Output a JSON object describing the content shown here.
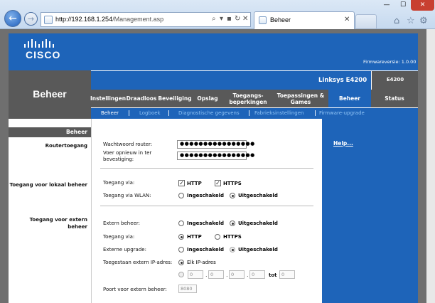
{
  "browser": {
    "url_host": "http://192.168.1.254",
    "url_path": "/Management.asp",
    "addr_icons": [
      "⌕",
      "▾",
      "▪",
      "↻",
      "✕"
    ],
    "tab_title": "Beheer",
    "tab_close": "✕",
    "back_glyph": "←",
    "fwd_glyph": "→",
    "min_glyph": "—",
    "max_glyph": "☐",
    "close_glyph": "✕",
    "home_icon": "⌂",
    "star_icon": "☆",
    "gear_icon": "⚙"
  },
  "header": {
    "logo": "CISCO",
    "firmware": "Firmwareversie: 1.0.00"
  },
  "section": {
    "title": "Beheer"
  },
  "model": {
    "name": "Linksys E4200",
    "code": "E4200"
  },
  "tabs": [
    {
      "label": "Instellingen"
    },
    {
      "label": "Draadloos"
    },
    {
      "label": "Beveiliging"
    },
    {
      "label": "Opslag"
    },
    {
      "label": "Toegangs-\nbeperkingen"
    },
    {
      "label": "Toepassingen &\nGames"
    },
    {
      "label": "Beheer"
    },
    {
      "label": "Status"
    }
  ],
  "subtabs": [
    {
      "label": "Beheer"
    },
    {
      "label": "Logboek"
    },
    {
      "label": "Diagnostische gegevens"
    },
    {
      "label": "Fabrieksinstellingen"
    },
    {
      "label": "Firmware-upgrade"
    }
  ],
  "left": {
    "header": "Beheer",
    "router_access": "Routertoegang",
    "local_access": "Toegang voor lokaal beheer",
    "remote_access": "Toegang voor extern\nbeheer"
  },
  "form": {
    "pw_label": "Wachtwoord router:",
    "pw_value": "●●●●●●●●●●●●●●●●",
    "pw2_label": "Voer opnieuw in ter\nbevestiging:",
    "pw2_value": "●●●●●●●●●●●●●●●●",
    "local_via_label": "Toegang via:",
    "http": "HTTP",
    "https": "HTTPS",
    "wlan_label": "Toegang via WLAN:",
    "enabled": "Ingeschakeld",
    "disabled": "Uitgeschakeld",
    "remote_label": "Extern  beheer:",
    "remote_via_label": "Toegang via:",
    "ext_upgrade_label": "Externe upgrade:",
    "allowed_ip_label": "Toegestaan extern IP-adres:",
    "any_ip": "Elk IP-adres",
    "ip_oct": [
      "0",
      "0",
      "0",
      "0"
    ],
    "ip_to_label": "tot",
    "ip_to_value": "0",
    "port_label": "Poort voor extern beheer:",
    "port_value": "8080"
  },
  "help": {
    "link": "Help..."
  }
}
